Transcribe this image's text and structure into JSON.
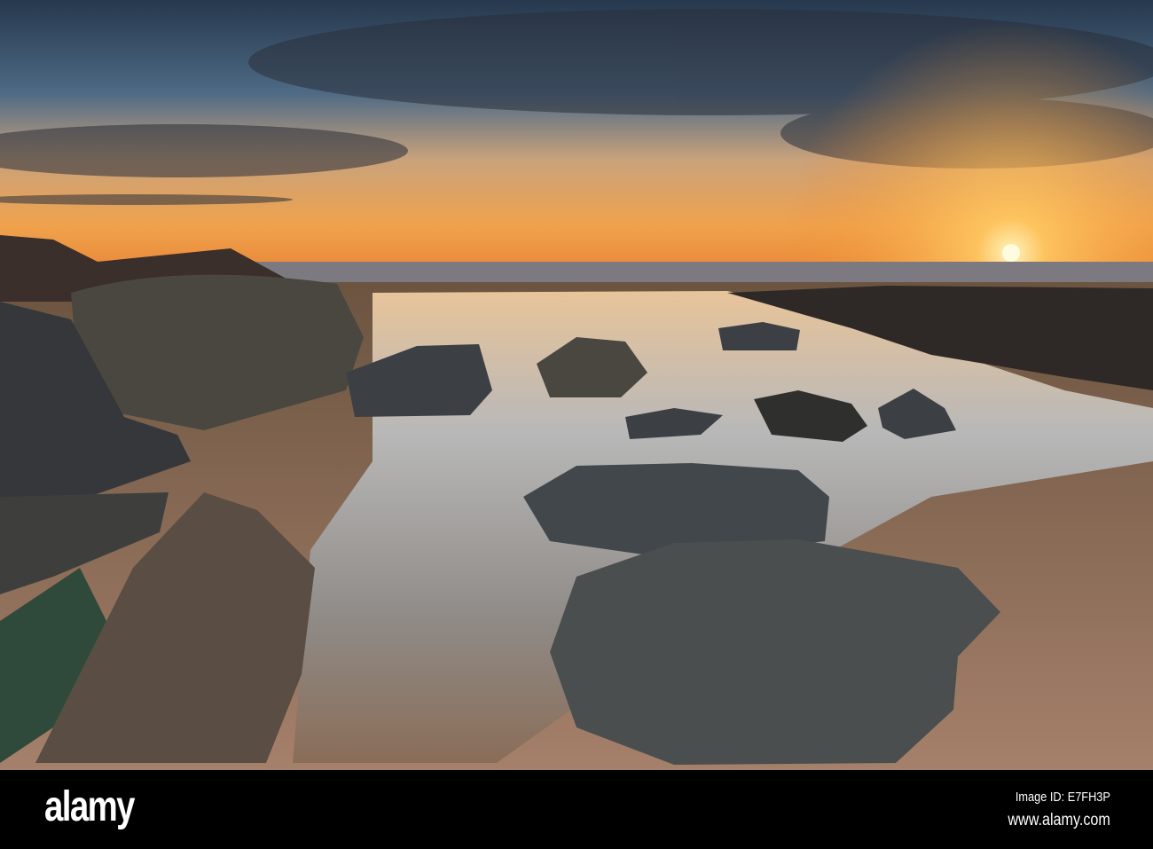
{
  "watermark": {
    "brand": "alamy"
  },
  "footer": {
    "logo": "alamy",
    "image_id": "Image ID: E7FH3P",
    "url": "www.alamy.com"
  },
  "colors": {
    "sky_top": "#2c3d52",
    "horizon": "#f2a64a",
    "sun": "#fff3b0",
    "sand": "#9a7a5e",
    "rock": "#3d4248"
  }
}
